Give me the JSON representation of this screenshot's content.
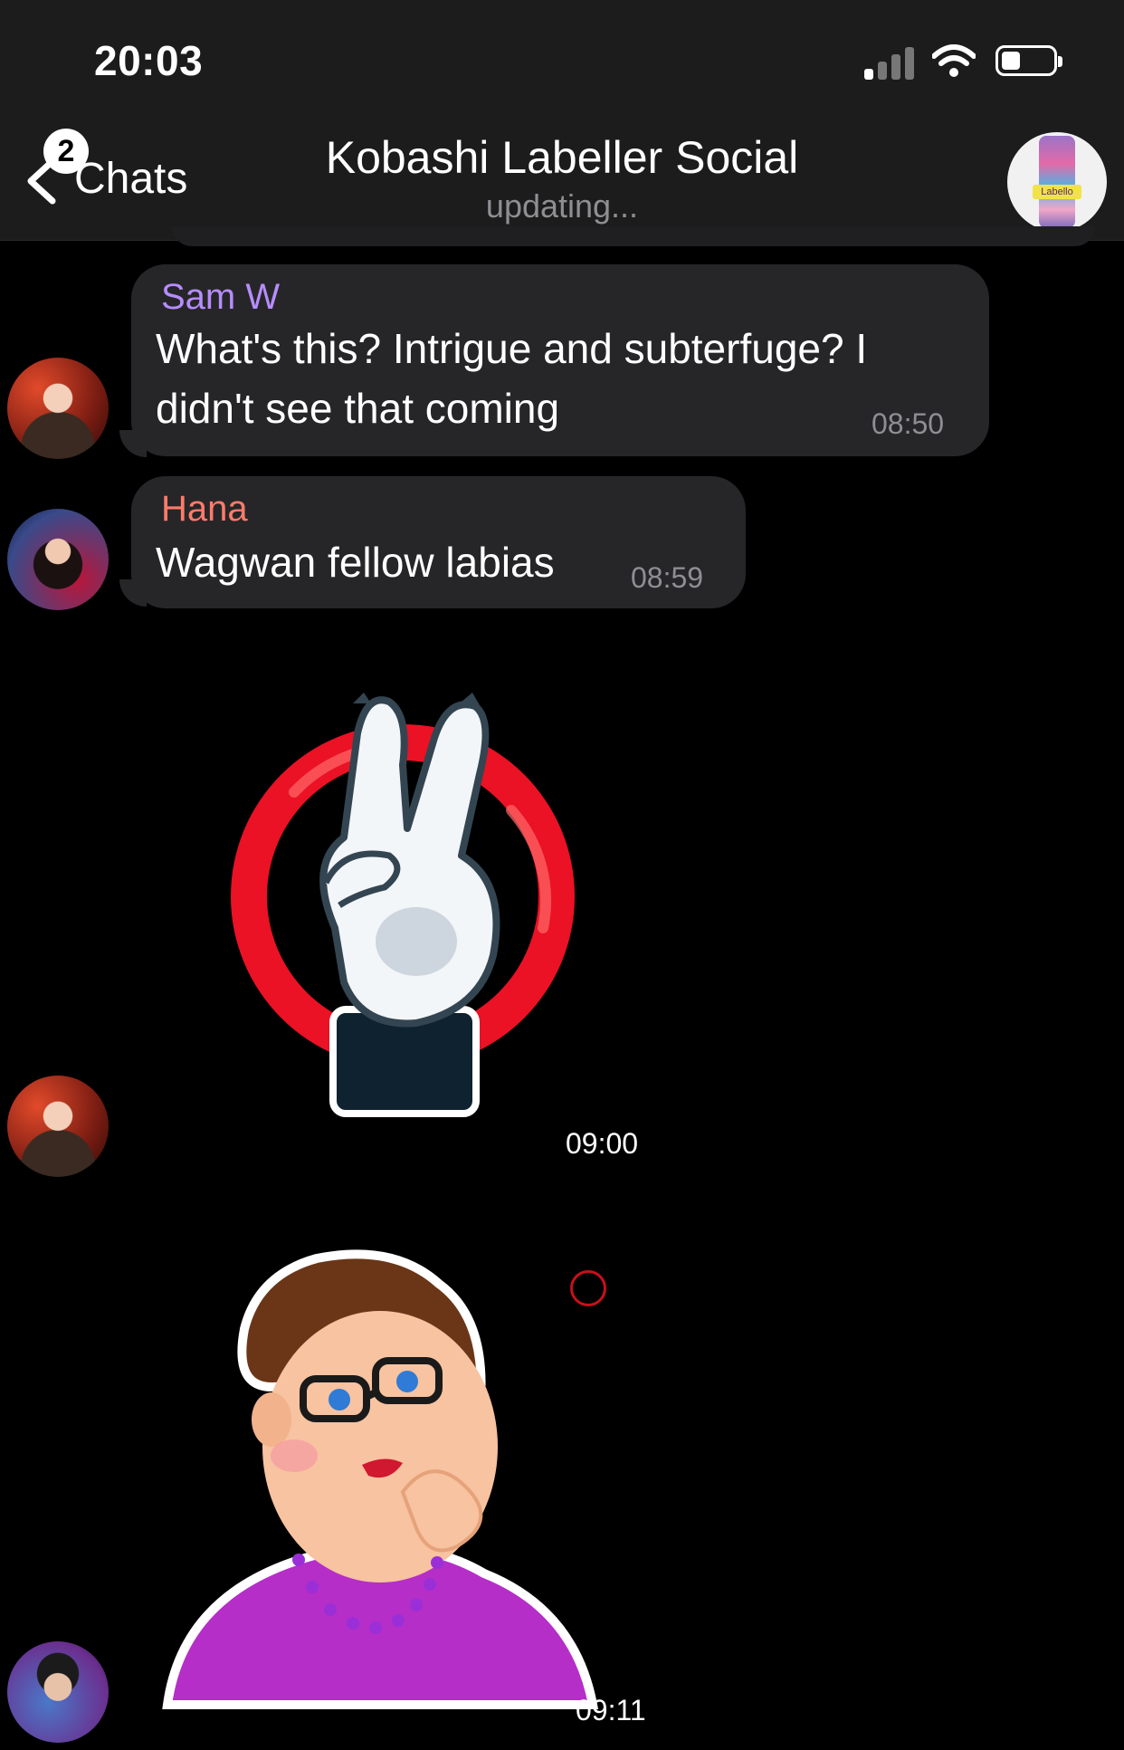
{
  "status_bar": {
    "time": "20:03"
  },
  "header": {
    "back_label": "Chats",
    "unread_badge": "2",
    "title": "Kobashi Labeller Social",
    "subtitle": "updating...",
    "group_avatar_label": "Labello"
  },
  "messages": [
    {
      "sender": "Sam W",
      "sender_color": "#b78cff",
      "text_line1": "What's this? Intrigue and subterfuge? I",
      "text_line2": "didn't see that coming",
      "time": "08:50"
    },
    {
      "sender": "Hana",
      "sender_color": "#ff7b6b",
      "text": "Wagwan fellow labias",
      "time": "08:59"
    },
    {
      "sticker": "peace-hand-sticker",
      "time": "09:00"
    },
    {
      "sticker": "woman-thinking-sticker",
      "time": "09:11"
    }
  ],
  "colors": {
    "bubble": "#262628",
    "header": "#1c1c1d",
    "background": "#000000"
  }
}
